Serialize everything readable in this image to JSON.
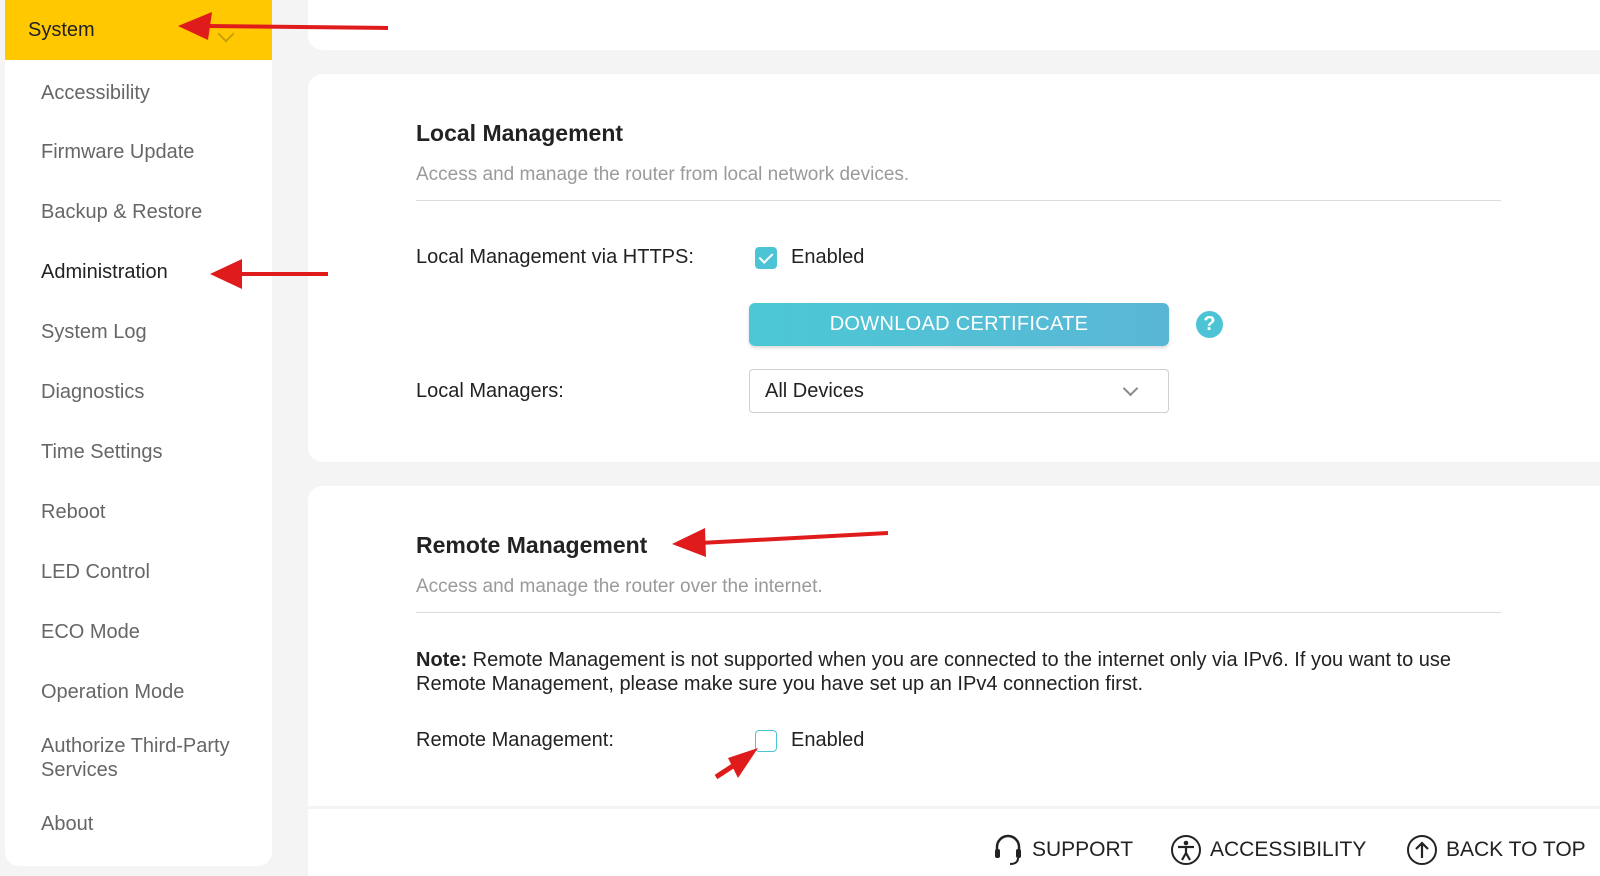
{
  "sidebar": {
    "header_label": "System",
    "items": [
      {
        "label": "Accessibility"
      },
      {
        "label": "Firmware Update"
      },
      {
        "label": "Backup & Restore"
      },
      {
        "label": "Administration"
      },
      {
        "label": "System Log"
      },
      {
        "label": "Diagnostics"
      },
      {
        "label": "Time Settings"
      },
      {
        "label": "Reboot"
      },
      {
        "label": "LED Control"
      },
      {
        "label": "ECO Mode"
      },
      {
        "label": "Operation Mode"
      },
      {
        "label": "Authorize Third-Party Services"
      },
      {
        "label": "About"
      }
    ],
    "active_item": "Administration"
  },
  "local_management": {
    "title": "Local Management",
    "description": "Access and manage the router from local network devices.",
    "https_label": "Local Management via HTTPS:",
    "https_checkbox_label": "Enabled",
    "https_enabled": true,
    "download_button_label": "DOWNLOAD CERTIFICATE",
    "help_label": "?",
    "managers_label": "Local Managers:",
    "managers_value": "All Devices"
  },
  "remote_management": {
    "title": "Remote Management",
    "description": "Access and manage the router over the internet.",
    "note_prefix": "Note:",
    "note_text": " Remote Management is not supported when you are connected to the internet only via IPv6. If you want to use Remote Management, please make sure you have set up an IPv4 connection first.",
    "remote_label": "Remote Management:",
    "remote_checkbox_label": "Enabled",
    "remote_enabled": false
  },
  "footer": {
    "support_label": "SUPPORT",
    "accessibility_label": "ACCESSIBILITY",
    "back_to_top_label": "BACK TO TOP"
  },
  "colors": {
    "accent": "#4cc4d6",
    "header_yellow": "#ffc800",
    "annotation_red": "#e01b1b"
  }
}
